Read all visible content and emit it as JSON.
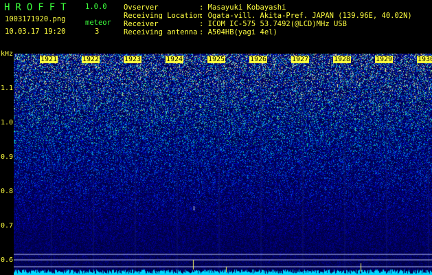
{
  "header": {
    "app_name": "HROFFT",
    "version": "1.0.0",
    "filename": "1003171920.png",
    "datetime": "10.03.17 19:20",
    "meteor_label": "meteor",
    "meteor_count": "3",
    "fields": [
      {
        "label": "Ovserver",
        "value": ": Masayuki Kobayashi"
      },
      {
        "label": "Receiving Location",
        "value": ": Ogata-vill. Akita-Pref. JAPAN (139.96E, 40.02N)"
      },
      {
        "label": "Receiver",
        "value": ": ICOM IC-575 53.7492(@LCD)MHz USB"
      },
      {
        "label": "Receiving antenna",
        "value": ": A504HB(yagi 4el)"
      }
    ]
  },
  "axis": {
    "unit": "kHz",
    "y_ticks": [
      "1.1",
      "1.0",
      "0.9",
      "0.8",
      "0.7",
      "0.6"
    ],
    "x_ticks": [
      "1921",
      "1922",
      "1923",
      "1924",
      "1925",
      "1926",
      "1927",
      "1928",
      "1929",
      "1930"
    ]
  },
  "colors": {
    "header_green": "#3cff3c",
    "header_yellow": "#ffff40",
    "background": "#000000",
    "spectrum_low": "#00007a",
    "spectrum_high": "#00ffa0"
  }
}
